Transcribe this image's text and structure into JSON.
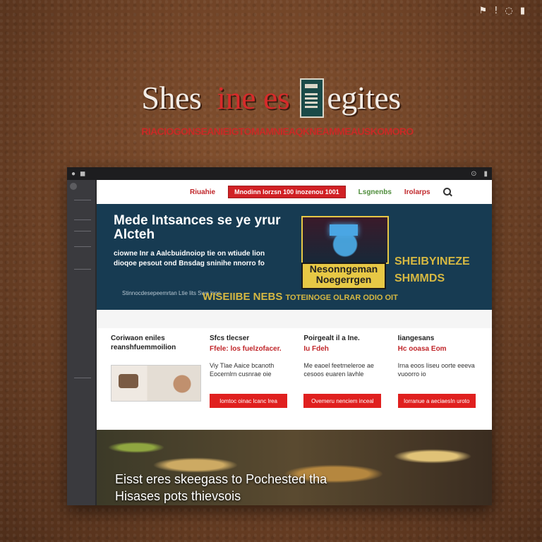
{
  "top_icons": [
    "flag-icon",
    "pin-icon",
    "globe-icon",
    "lock-icon"
  ],
  "top_icon_glyphs": [
    "⚑",
    "!",
    "◌",
    "▮"
  ],
  "hero": {
    "title_part1": "Shes",
    "title_part2": "ine es",
    "title_part3": "egites",
    "subtitle": "RIACIOGONSEANIEIGTOMAMNIEAQKNEAMMEAUSKOMORO"
  },
  "window": {
    "bar_left": [
      "●",
      "◼"
    ],
    "bar_right": [
      "⊙",
      "▮"
    ]
  },
  "nav": {
    "link1": "Riuahie",
    "cta": "Mnodinn lorzsn 100 inozenou 1001",
    "link2": "Lsgnenbs",
    "link3": "Irolarps"
  },
  "banner": {
    "headline1": "Mede Intsances se ye yrur",
    "headline2": "Alcteh",
    "para1": "ciowne Inr a Aalcbuidnoiop tie on wtiude lion",
    "para2": "dioqoe pesout ond Bnsdag sninihe nnorro fo",
    "note": "Stinnocdesepeemrtan  Ltie lits Swe lnns",
    "badge": "Nesonngeman Noegerrgen",
    "side1": "SHEIBYINEZE",
    "side2": "SHMMDS",
    "strip_big": "WISEIIBE NEBS",
    "strip_small": "TOTEINOGE OLRAR ODIO OIT"
  },
  "cards": [
    {
      "title1": "Coriwaon eniles",
      "title2": "reanshfuemmoilion",
      "red": "",
      "body": "",
      "button": "",
      "has_thumb": true
    },
    {
      "title1": "Sfcs tlecser",
      "title2": "",
      "red": "Ffele: los fuelzofacer.",
      "body": "Viy Tlae Aaice bcanoth Eocernlrn cusnrae oie",
      "button": "Iomtoc oinac lcanc lrea"
    },
    {
      "title1": "Poirgealt il a Ine.",
      "title2": "",
      "red": "Iu  Fdeh",
      "body": "Me eaoel feetmeleroe ae cesoos euaren lavhle",
      "button": "Ovemeru nenciem inceal"
    },
    {
      "title1": "Iiangesans",
      "title2": "",
      "red": "Hc ooasa Eom",
      "body": "Irna eoos Iiseu oorte eeeva vuoorro io",
      "button": "Iorranue a aeciaesIn uroto"
    }
  ],
  "photo": {
    "line1": "Eisst eres skeegass to Pochested tha",
    "line2": "Hisases pots thievsois"
  }
}
